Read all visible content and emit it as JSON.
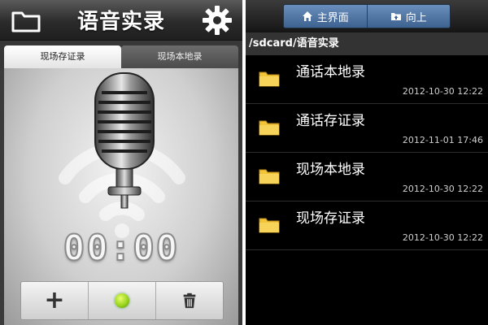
{
  "recorder": {
    "title": "语音实录",
    "tabs": [
      "现场存证录",
      "现场本地录"
    ],
    "timer": "00:00",
    "icons": {
      "folder": "folder-icon",
      "settings": "gear-icon",
      "microphone": "microphone-icon",
      "add": "plus-icon",
      "record": "record-indicator",
      "delete": "trash-icon"
    },
    "colors": {
      "record": "#9ad41e"
    }
  },
  "browser": {
    "nav": {
      "home_label": "主界面",
      "up_label": "向上"
    },
    "path": "/sdcard/语音实录",
    "items": [
      {
        "name": "通话本地录",
        "time": "2012-10-30 12:22"
      },
      {
        "name": "通话存证录",
        "time": "2012-11-01 17:46"
      },
      {
        "name": "现场本地录",
        "time": "2012-10-30 12:22"
      },
      {
        "name": "现场存证录",
        "time": "2012-10-30 12:22"
      }
    ],
    "colors": {
      "folder": "#f2c43a",
      "nav_button": "#4f74a3"
    }
  }
}
